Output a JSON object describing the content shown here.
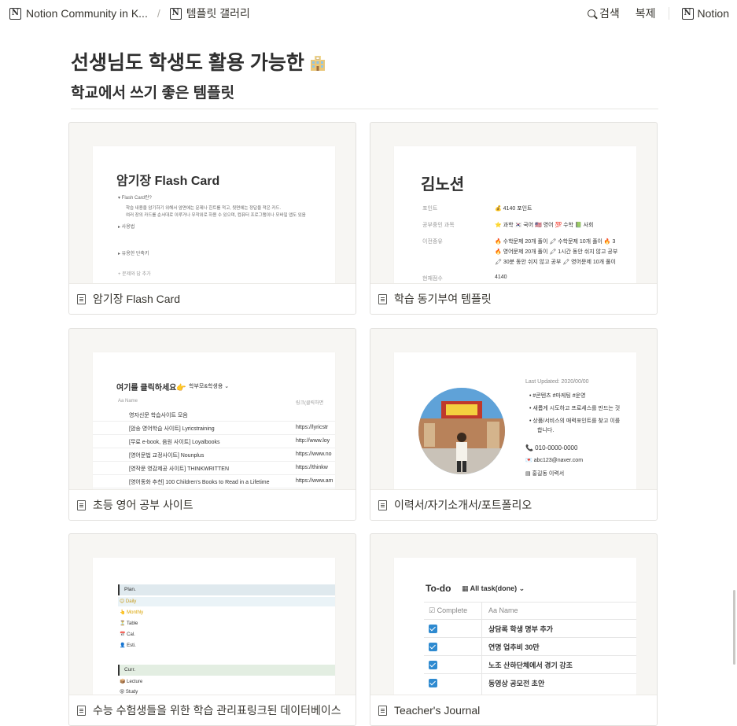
{
  "topbar": {
    "crumb1": "Notion Community in K...",
    "separator": "/",
    "crumb2": "템플릿 갤러리",
    "search": "검색",
    "duplicate": "복제",
    "brand": "Notion",
    "logo_letter": "N"
  },
  "page": {
    "title": "선생님도 학생도 활용 가능한",
    "subtitle": "학교에서 쓰기 좋은 템플릿"
  },
  "cards": [
    {
      "caption": "암기장 Flash Card",
      "preview": {
        "title": "암기장 Flash Card",
        "toggle1": "▾  Flash Card란?",
        "desc1": "학습 내용을 암기하기 위해서 앞면에는 문제나 힌트를 적고, 뒷면에는 정답을 적은 카드.",
        "desc2": "여러 장의 카드를 순서대로 이루거나 무작위로 하용 수 있으며, 컴퓨터 프로그램이나 모바일 앱도 있음",
        "toggle2": "▸  사용법",
        "toggle3": "▸  유용한 단축키",
        "add": "+ 문제와 답 추가"
      }
    },
    {
      "caption": "학습 동기부여 템플릿",
      "preview": {
        "title": "김노션",
        "rows": [
          {
            "label": "포인트",
            "value": "💰 4140 포인트"
          },
          {
            "label": "공부중인 과목",
            "value": "⭐ 과학  🇰🇷 국어  🇺🇸 영어  💯 수학  📗 사회"
          },
          {
            "label": "이전중유",
            "value": "🔥 수학문제 20개 풀이  🖍 수학문제 10개 풀이  🔥 3"
          },
          {
            "label": "",
            "value": "🔥 영어문제 20개 풀이  🖍 1시간 동안 쉬지 않고 공부"
          },
          {
            "label": "",
            "value": "🖍 30분 동안 쉬지 않고 공부  🖍 영어문제 10개 풀이"
          },
          {
            "label": "현재점수",
            "value": "4140"
          }
        ]
      }
    },
    {
      "caption": "초등 영어 공부 사이트",
      "preview": {
        "title": "여기를 클릭하세요👉",
        "view": "학부모&학생용 ⌄",
        "col_name": "Aa Name",
        "col_link": "링크(클릭하면",
        "rows": [
          {
            "name": "영자신문 학습사이트 모음",
            "link": ""
          },
          {
            "name": "[암송 영어학습 사이트] Lyricstraining",
            "link": "https://lyricstr"
          },
          {
            "name": "[무료 e-book, 음원 사이트] Loyalbooks",
            "link": "http://www.loy"
          },
          {
            "name": "[영어문법 교정사이트] Nounplus",
            "link": "https://www.no"
          },
          {
            "name": "[영작문 영감제공 사이트] THINKWRITTEN",
            "link": "https://thinkw"
          },
          {
            "name": "[영어동화 추천] 100 Children's Books to Read in a Lifetime",
            "link": "https://www.am"
          }
        ]
      }
    },
    {
      "caption": "이력서/자기소개서/포트폴리오",
      "preview": {
        "updated": "Last Updated: 2020/00/00",
        "bullets": [
          "#콘텐츠 #마케팅 #운영",
          "새롭게 시도하고 프로세스를 만드는 것",
          "상품/서비스의 매력포인트를 찾고 이를",
          "합니다."
        ],
        "phone": "📞 010-0000-0000",
        "email": "💌 abc123@naver.com",
        "name": "▤ 홍길동 이력서"
      }
    },
    {
      "caption": "수능 수험생들을 위한 학습 관리표링크된 데이터베이스",
      "preview": {
        "section1": "Plan.",
        "items1": [
          "😊 Daily",
          "👆 Monthly",
          "⏳ Table",
          "📅 Cal.",
          "👤 Esti."
        ],
        "section2": "Curr.",
        "items2": [
          "📦 Lecture",
          "😵 Study"
        ]
      }
    },
    {
      "caption": "Teacher's Journal",
      "preview": {
        "title": "To-do",
        "view": "▦ All task(done) ⌄",
        "col_complete": "☑ Complete",
        "col_name": "Aa Name",
        "rows": [
          "상담록 학생 명부 추가",
          "연명 업추비 30만",
          "노조 산하단체에서 경기 강조",
          "동영상 공모전 초안"
        ]
      }
    }
  ],
  "colors": {
    "accent_blue": "#2e8ad0",
    "text": "#37352f",
    "card_bg": "#f7f6f3"
  }
}
